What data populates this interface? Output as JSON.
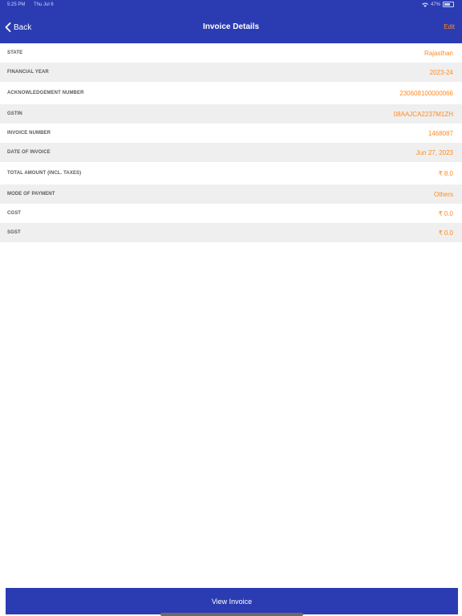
{
  "status_bar": {
    "time": "5:25 PM",
    "date": "Thu Jul 6",
    "battery": "47%"
  },
  "nav": {
    "back_label": "Back",
    "title": "Invoice Details",
    "edit_label": "Edit"
  },
  "details": [
    {
      "label": "STATE",
      "value": "Rajasthan"
    },
    {
      "label": "FINANCIAL YEAR",
      "value": "2023-24"
    },
    {
      "label": "ACKNOWLEDGEMENT NUMBER",
      "value": "230608100000066"
    },
    {
      "label": "GSTIN",
      "value": "08AAJCA2237M1ZH"
    },
    {
      "label": "INVOICE NUMBER",
      "value": "1468087"
    },
    {
      "label": "DATE OF INVOICE",
      "value": "Jun 27, 2023"
    },
    {
      "label": "TOTAL AMOUNT (INCL. TAXES)",
      "value": "₹ 8.0"
    },
    {
      "label": "MODE OF PAYMENT",
      "value": "Others"
    },
    {
      "label": "CGST",
      "value": "₹ 0.0"
    },
    {
      "label": "SGST",
      "value": "₹ 0.0"
    }
  ],
  "footer": {
    "view_invoice_label": "View Invoice"
  },
  "colors": {
    "primary": "#2b3cb2",
    "accent": "#ff8a1f",
    "row_alt": "#efefef"
  }
}
